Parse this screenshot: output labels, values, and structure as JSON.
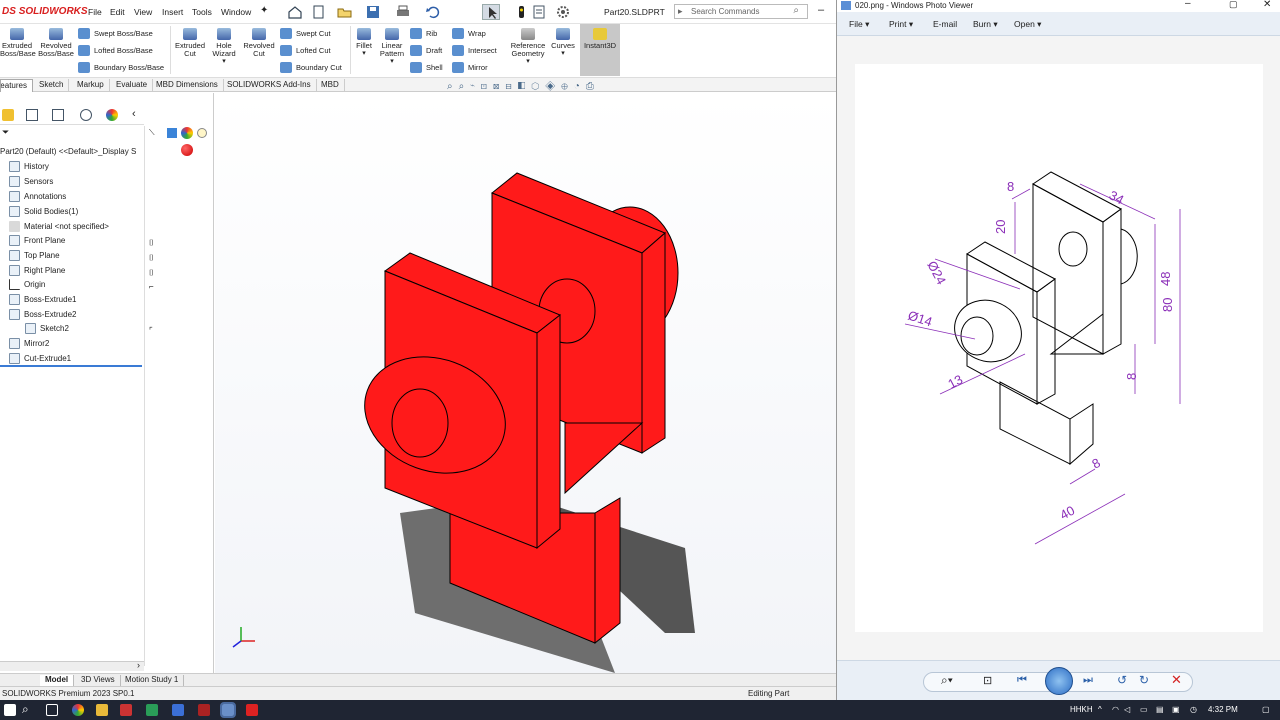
{
  "sw": {
    "logo_prefix": "DS",
    "logo_name": "SOLIDWORKS",
    "menu": [
      "File",
      "Edit",
      "View",
      "Insert",
      "Tools",
      "Window"
    ],
    "doc_title": "Part20.SLDPRT",
    "search_placeholder": "Search Commands",
    "ribbon": {
      "extruded_boss": "Extruded Boss/Base",
      "revolved_boss": "Revolved Boss/Base",
      "swept_boss": "Swept Boss/Base",
      "lofted_boss": "Lofted Boss/Base",
      "boundary_boss": "Boundary Boss/Base",
      "extruded_cut": "Extruded Cut",
      "hole_wizard": "Hole Wizard",
      "revolved_cut": "Revolved Cut",
      "swept_cut": "Swept Cut",
      "lofted_cut": "Lofted Cut",
      "boundary_cut": "Boundary Cut",
      "fillet": "Fillet",
      "linear_pattern": "Linear Pattern",
      "rib": "Rib",
      "draft": "Draft",
      "shell": "Shell",
      "wrap": "Wrap",
      "intersect": "Intersect",
      "mirror": "Mirror",
      "reference_geometry": "Reference Geometry",
      "curves": "Curves",
      "instant3d": "Instant3D"
    },
    "tabs": [
      "Features",
      "Sketch",
      "Markup",
      "Evaluate",
      "MBD Dimensions",
      "SOLIDWORKS Add-Ins",
      "MBD"
    ],
    "tree": [
      "Part20 (Default) <<Default>_Display S",
      "History",
      "Sensors",
      "Annotations",
      "Solid Bodies(1)",
      "Material <not specified>",
      "Front Plane",
      "Top Plane",
      "Right Plane",
      "Origin",
      "Boss-Extrude1",
      "Boss-Extrude2",
      "Sketch2",
      "Mirror2",
      "Cut-Extrude1"
    ],
    "bottom_tabs": [
      "Model",
      "3D Views",
      "Motion Study 1"
    ],
    "status_left": "SOLIDWORKS Premium 2023 SP0.1",
    "status_right": "Editing Part",
    "model_color": "#ff1a1a"
  },
  "pv": {
    "title": "020.png - Windows Photo Viewer",
    "menu": [
      "File",
      "Print",
      "E-mail",
      "Burn",
      "Open"
    ],
    "dims": {
      "d8_top": "8",
      "d34": "34",
      "d20": "20",
      "d24": "Ø24",
      "d14": "Ø14",
      "d48": "48",
      "d80": "80",
      "d13": "13",
      "d8_mid": "8",
      "d8_bot": "8",
      "d40": "40"
    },
    "dim_color": "#8b2fb8"
  },
  "taskbar": {
    "lang": "HHKH",
    "time": "4:32 PM"
  }
}
